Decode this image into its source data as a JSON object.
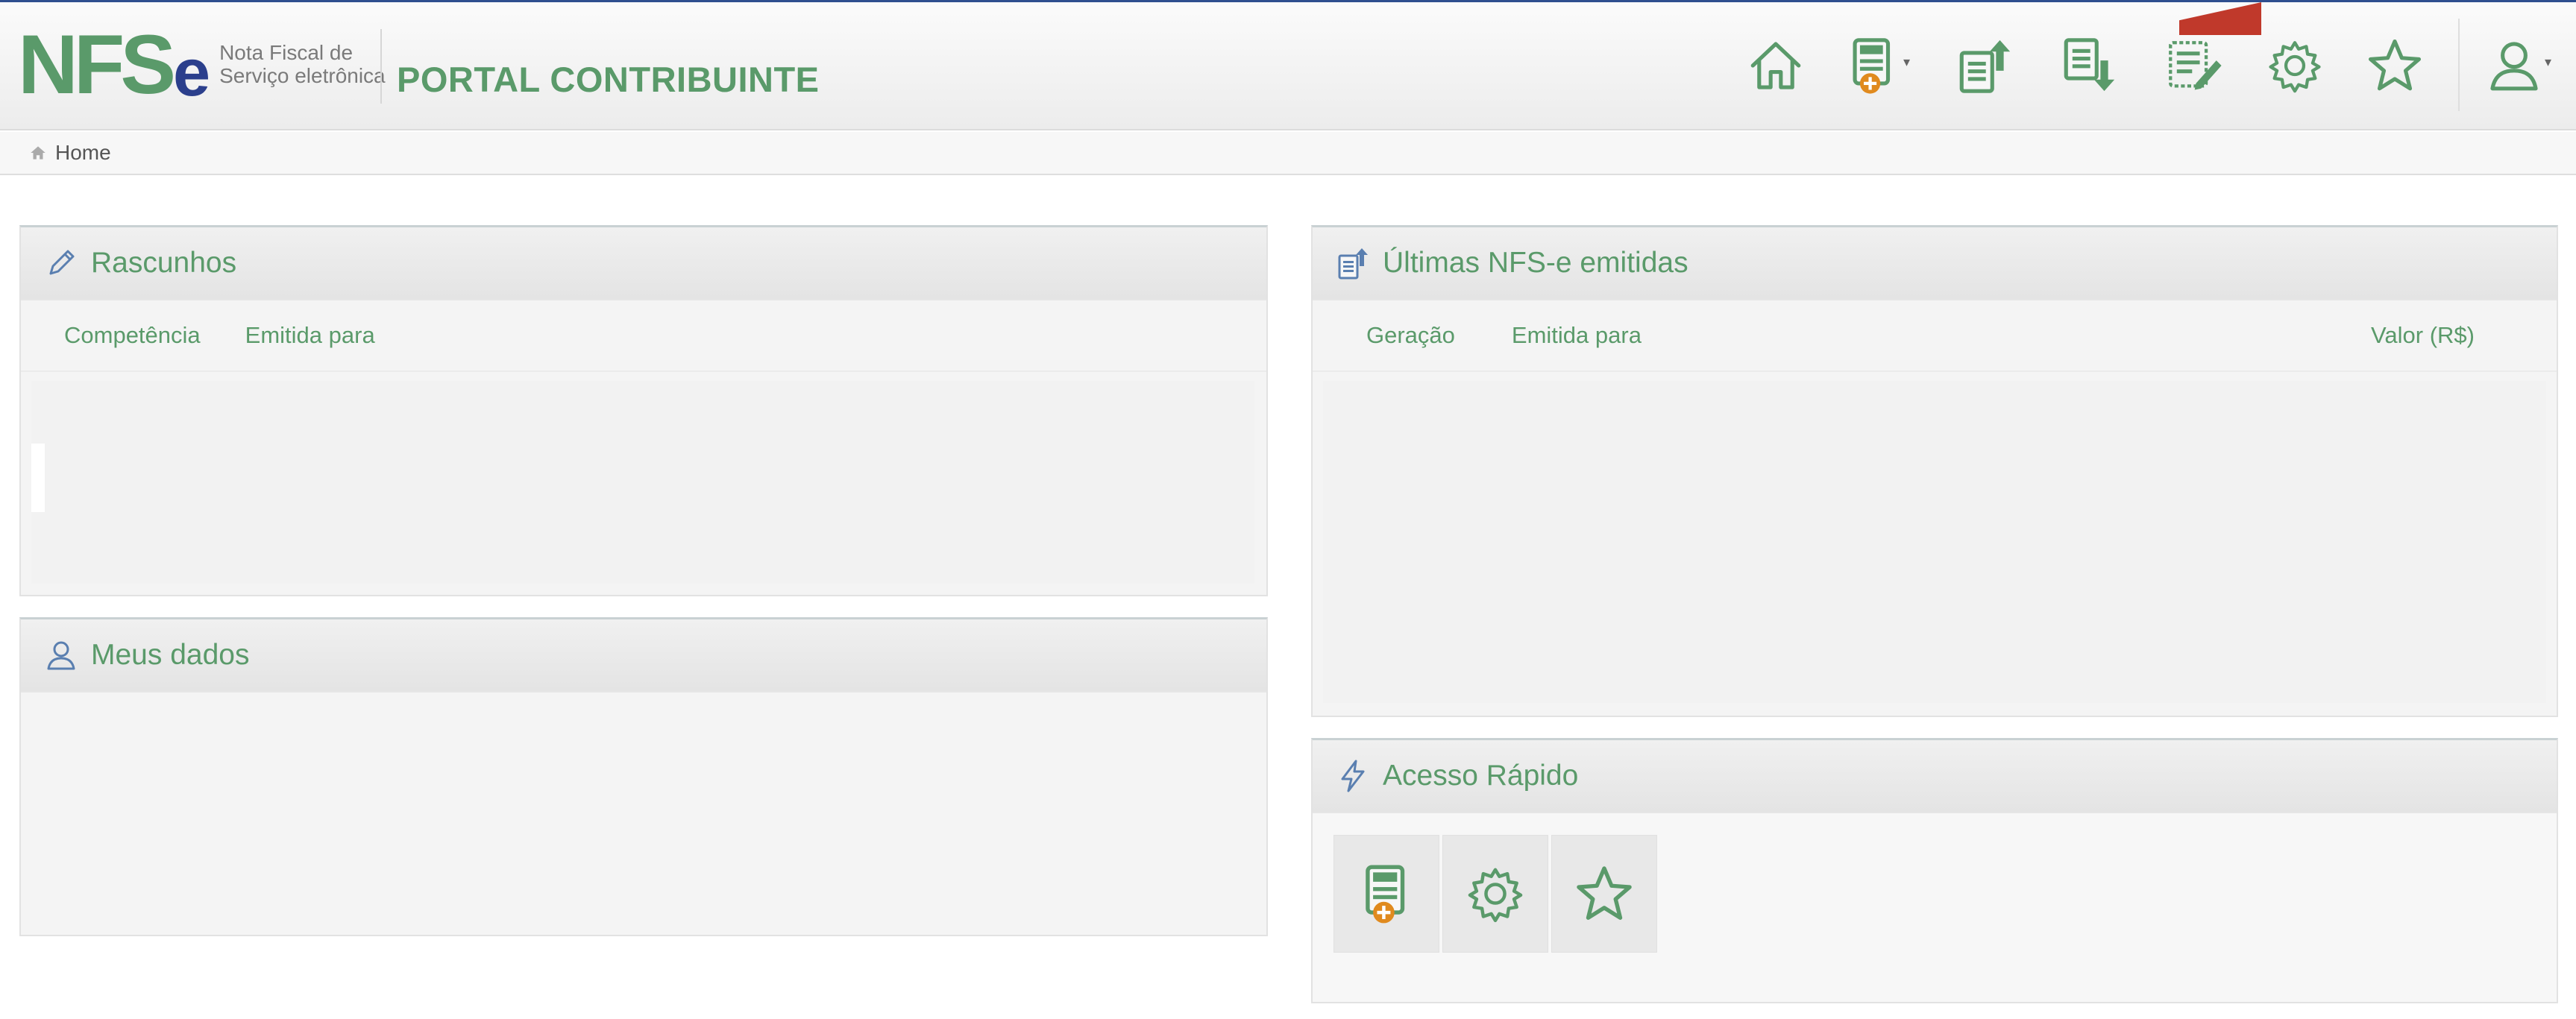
{
  "header": {
    "logo": {
      "mark_n": "N",
      "mark_f": "F",
      "mark_s": "S",
      "mark_e": "e",
      "subtitle_line1": "Nota Fiscal de",
      "subtitle_line2": "Serviço eletrônica"
    },
    "portal_title": "PORTAL CONTRIBUINTE",
    "nav_icons": [
      "home-icon",
      "new-nfse-icon",
      "upload-document-icon",
      "download-document-icon",
      "edit-document-icon",
      "gear-icon",
      "star-icon",
      "user-icon"
    ]
  },
  "breadcrumb": {
    "home_label": "Home"
  },
  "rascunhos": {
    "title": "Rascunhos",
    "columns": [
      "Competência",
      "Emitida para"
    ]
  },
  "meus_dados": {
    "title": "Meus dados"
  },
  "ultimas": {
    "title": "Últimas NFS-e emitidas",
    "columns": [
      "Geração",
      "Emitida para",
      "Valor (R$)"
    ]
  },
  "acesso_rapido": {
    "title": "Acesso Rápido",
    "items": [
      "new-nfse-icon",
      "gear-icon",
      "star-icon"
    ]
  },
  "colors": {
    "accent_green": "#5a9a6a",
    "brand_blue": "#2b3f8c",
    "nfse_orange": "#e08a1e",
    "marker_red": "#c0392b"
  }
}
